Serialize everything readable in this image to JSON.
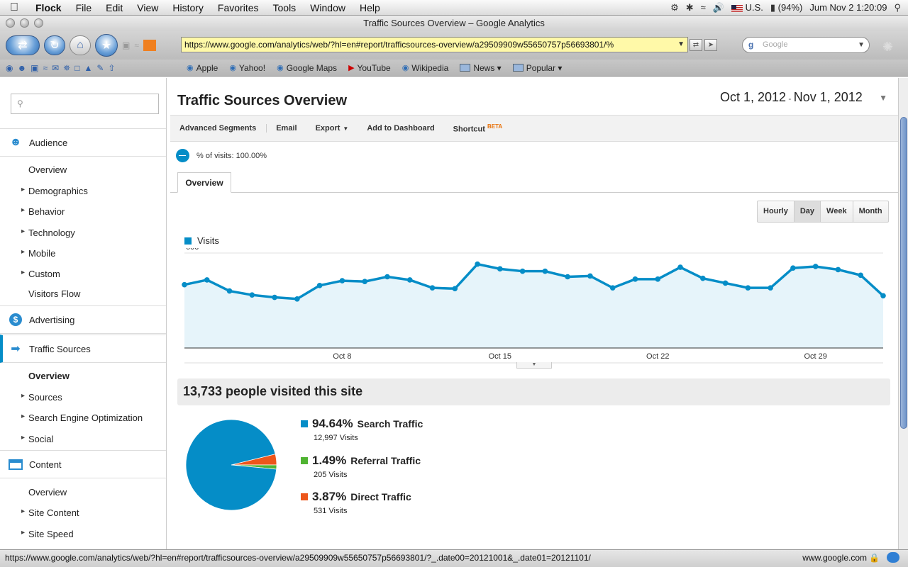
{
  "os_menubar": {
    "app_name": "Flock",
    "menus": [
      "File",
      "Edit",
      "View",
      "History",
      "Favorites",
      "Tools",
      "Window",
      "Help"
    ],
    "input_source": "U.S.",
    "battery": "(94%)",
    "clock": "Jum Nov 2  1:20:09"
  },
  "window": {
    "title": "Traffic Sources Overview – Google Analytics"
  },
  "browser": {
    "url": "https://www.google.com/analytics/web/?hl=en#report/trafficsources-overview/a29509909w55650757p56693801/%",
    "search_placeholder": "Google",
    "bookmarks": [
      {
        "label": "Apple",
        "icon": "globe-icon"
      },
      {
        "label": "Yahoo!",
        "icon": "globe-icon"
      },
      {
        "label": "Google Maps",
        "icon": "globe-icon"
      },
      {
        "label": "YouTube",
        "icon": "youtube-icon"
      },
      {
        "label": "Wikipedia",
        "icon": "globe-icon"
      },
      {
        "label": "News ▾",
        "icon": "folder-icon"
      },
      {
        "label": "Popular ▾",
        "icon": "folder-icon"
      }
    ]
  },
  "sidebar": {
    "sections": [
      {
        "key": "audience",
        "label": "Audience",
        "icon": "audience-icon"
      },
      {
        "key": "advertising",
        "label": "Advertising",
        "icon": "dollar-icon"
      },
      {
        "key": "traffic",
        "label": "Traffic Sources",
        "icon": "traffic-arrow-icon"
      },
      {
        "key": "content",
        "label": "Content",
        "icon": "content-icon"
      }
    ],
    "audience_items": [
      "Overview",
      "Demographics",
      "Behavior",
      "Technology",
      "Mobile",
      "Custom",
      "Visitors Flow"
    ],
    "traffic_items": [
      "Overview",
      "Sources",
      "Search Engine Optimization",
      "Social"
    ],
    "content_items": [
      "Overview",
      "Site Content",
      "Site Speed"
    ]
  },
  "report": {
    "title": "Traffic Sources Overview",
    "date_start": "Oct 1, 2012",
    "date_sep": " - ",
    "date_end": "Nov 1, 2012",
    "actions": {
      "segments": "Advanced Segments",
      "email": "Email",
      "export": "Export",
      "dashboard": "Add to Dashboard",
      "shortcut": "Shortcut",
      "beta": "BETA"
    },
    "segment_text": "% of visits: 100.00%",
    "tab": "Overview",
    "granularity": [
      "Hourly",
      "Day",
      "Week",
      "Month"
    ],
    "granularity_selected": "Day",
    "visited_text": "13,733 people visited this site",
    "colors": {
      "accent": "#058dc7",
      "area": "#e6f4fa",
      "referral": "#50b432",
      "direct": "#ed561b"
    }
  },
  "chart_data": [
    {
      "type": "area",
      "series": [
        {
          "name": "Visits",
          "values": [
            400,
            430,
            360,
            335,
            320,
            310,
            395,
            425,
            420,
            450,
            430,
            380,
            375,
            530,
            500,
            485,
            485,
            450,
            455,
            380,
            435,
            435,
            510,
            440,
            410,
            380,
            380,
            505,
            515,
            495,
            460,
            330
          ]
        }
      ],
      "x_ticks": [
        "Oct 8",
        "Oct 15",
        "Oct 22",
        "Oct 29"
      ],
      "x_tick_index": [
        7,
        14,
        21,
        28
      ],
      "y_ticks": [
        300,
        600
      ],
      "ylim": [
        0,
        600
      ],
      "grid": true
    },
    {
      "type": "pie",
      "slices": [
        {
          "label": "Search Traffic",
          "percent": "94.64%",
          "value": 94.64,
          "visits": "12,997 Visits",
          "color": "#058dc7"
        },
        {
          "label": "Referral Traffic",
          "percent": "1.49%",
          "value": 1.49,
          "visits": "205 Visits",
          "color": "#50b432"
        },
        {
          "label": "Direct Traffic",
          "percent": "3.87%",
          "value": 3.87,
          "visits": "531 Visits",
          "color": "#ed561b"
        }
      ]
    }
  ],
  "status": {
    "url": "https://www.google.com/analytics/web/?hl=en#report/trafficsources-overview/a29509909w55650757p56693801/?_.date00=20121001&_.date01=20121101/",
    "host": "www.google.com"
  }
}
